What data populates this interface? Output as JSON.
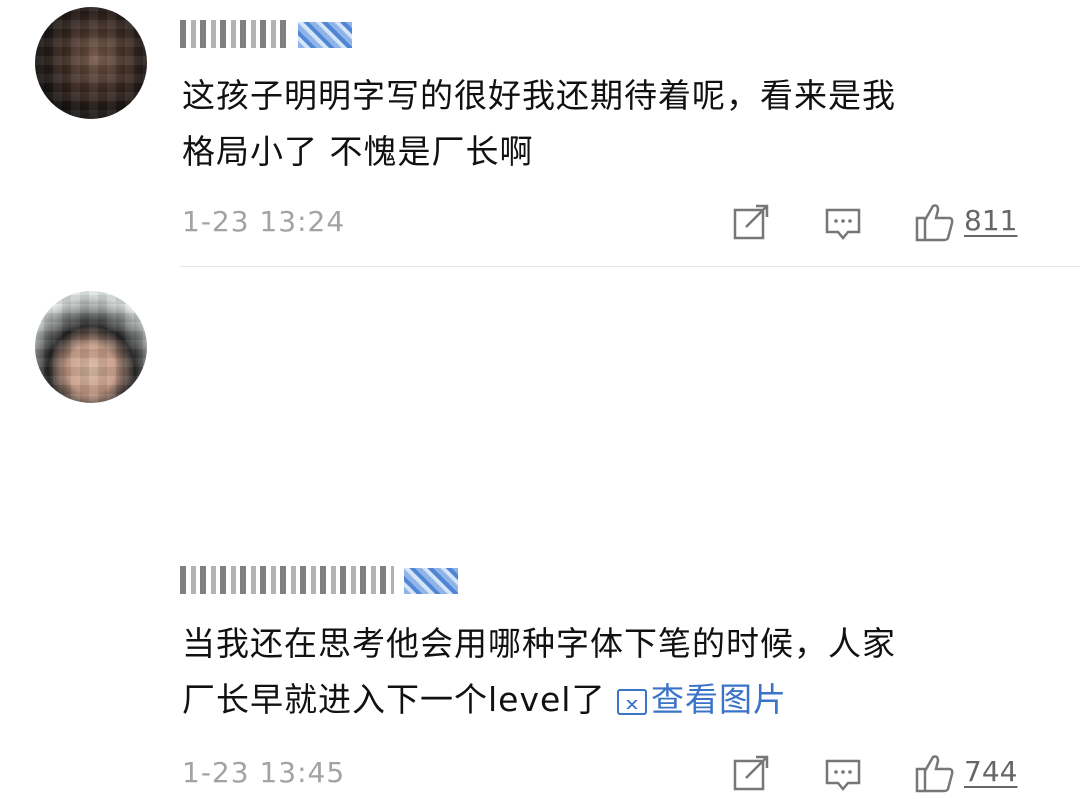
{
  "comments": [
    {
      "text_line1": "这孩子明明字写的很好我还期待着呢，看来是我",
      "text_line2": "格局小了 不愧是厂长啊",
      "time": "1-23 13:24",
      "likes": "811",
      "icons": [
        "share-icon",
        "comment-icon",
        "like-icon"
      ]
    },
    {
      "text_line1": "当我还在思考他会用哪种字体下笔的时候，人家",
      "text_line2": "厂长早就进入下一个level了",
      "image_link": "查看图片",
      "time": "1-23 13:45",
      "likes": "744",
      "icons": [
        "image-icon",
        "share-icon",
        "comment-icon",
        "like-icon"
      ]
    }
  ],
  "colors": {
    "link": "#3a73c8",
    "meta": "#a3a3a3",
    "text": "#111111",
    "divider": "#e6e6e6"
  }
}
